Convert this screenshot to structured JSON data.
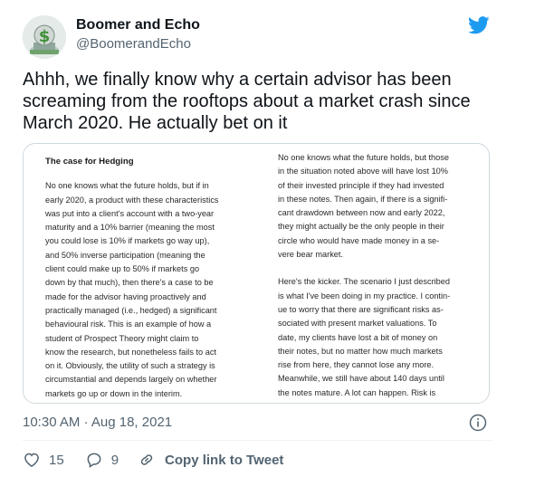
{
  "author": {
    "name": "Boomer and Echo",
    "handle": "@BoomerandEcho"
  },
  "tweet": {
    "text": "Ahhh, we finally know why a certain advisor has been screaming from the rooftops about a market crash since March 2020. He actually bet on it",
    "timestamp": "10:30 AM · Aug 18, 2021"
  },
  "image": {
    "heading": "The case for Hedging",
    "left_paragraph": "No one knows what the future holds, but if in\nearly 2020, a product with these characteristics\nwas put into a client's account with a two-year\nmaturity and a 10% barrier (meaning the most\nyou could lose is 10% if markets go way up),\nand 50% inverse participation (meaning the\nclient could make up to 50% if markets go\ndown by that much), then there's a case to be\nmade for the advisor having proactively and\npractically managed (i.e., hedged) a significant\nbehavioural risk. This is an example of how a\nstudent of Prospect Theory might claim to\nknow the research, but nonetheless fails to act\non it. Obviously, the utility of such a strategy is\ncircumstantial and depends largely on whether\nmarkets go up or down in the interim.",
    "right_paragraph_1": "No one knows what the future holds, but those\nin the situation noted above will have lost 10%\nof their invested principle if they had invested\nin these notes. Then again, if there is a signifi-\ncant drawdown between now and early 2022,\nthey might actually be the only people in their\ncircle who would have made money in a se-\nvere bear market.",
    "right_paragraph_2": "Here's the kicker. The scenario I just described\nis what I've been doing in my practice. I contin-\nue to worry that there are significant risks as-\nsociated with present market valuations. To\ndate, my clients have lost a bit of money on\ntheir notes, but no matter how much markets\nrise from here, they cannot lose any more.\nMeanwhile, we still have about 140 days until\nthe notes mature. A lot can happen. Risk is\nreal."
  },
  "actions": {
    "like_count": "15",
    "reply_count": "9",
    "copy_link_label": "Copy link to Tweet"
  },
  "colors": {
    "twitter_blue": "#1d9bf0",
    "text_secondary": "#536471",
    "border": "#cfd9de"
  }
}
